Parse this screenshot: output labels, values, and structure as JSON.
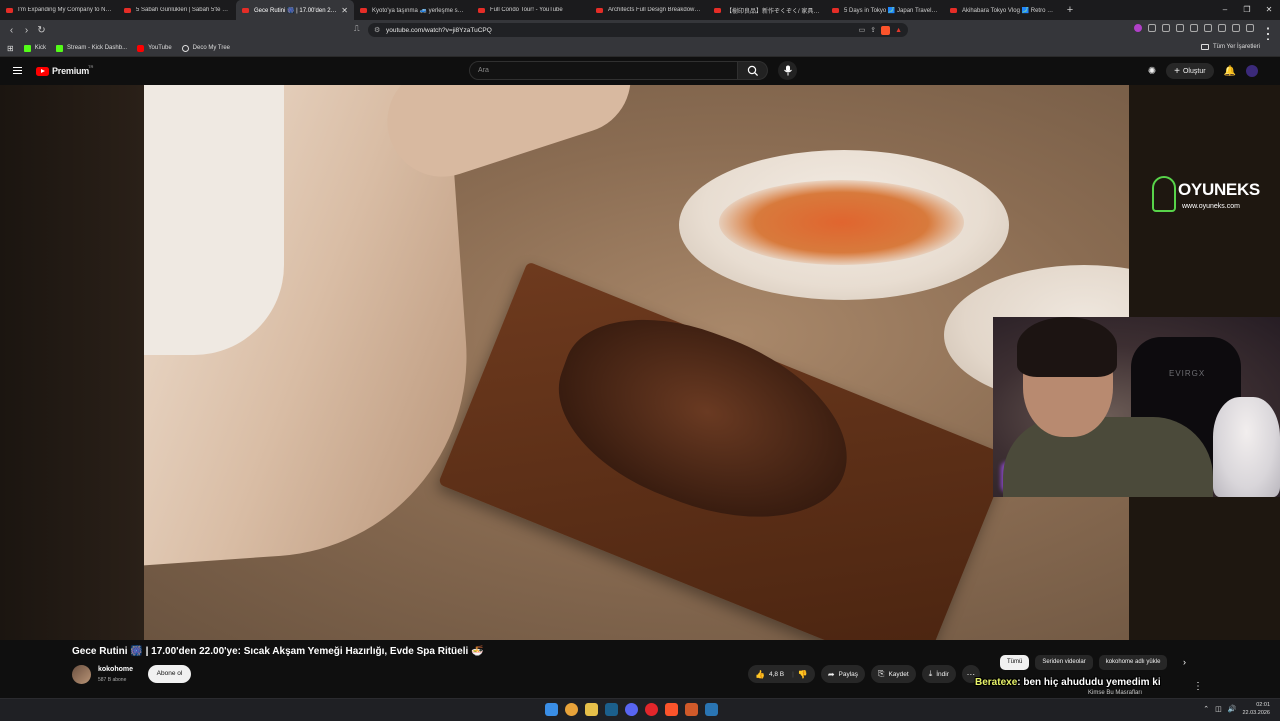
{
  "browser": {
    "tabs": [
      {
        "title": "I'm Expanding My Company to New",
        "active": false
      },
      {
        "title": "5 Sabah Günlükleri | Sabah 5'te uyan",
        "active": false
      },
      {
        "title": "Gece Rutini 🎆 | 17.00'den 22.0",
        "active": true
      },
      {
        "title": "Kyoto'ya taşınma 🚙 yerleşme süreci",
        "active": false
      },
      {
        "title": "Full Condo Tour! - YouTube",
        "active": false
      },
      {
        "title": "Architects Full Design Breakdown of",
        "active": false
      },
      {
        "title": "【樹印良品】新作ぞくぞく/ 家具が良さ",
        "active": false
      },
      {
        "title": "5 Days in Tokyo 🗾 Japan Travel Vlog",
        "active": false
      },
      {
        "title": "Akihabara Tokyo Vlog 🗾 Retro Game",
        "active": false
      }
    ],
    "close_tab_glyph": "✕",
    "new_tab_glyph": "+",
    "window_controls": [
      "–",
      "❐",
      "✕"
    ],
    "url": "youtube.com/watch?v=ji8YzaTuCPQ",
    "bookmarks": [
      {
        "label": "Kick",
        "color": "#53fc18"
      },
      {
        "label": "Stream - Kick Dashb...",
        "color": "#53fc18"
      },
      {
        "label": "YouTube",
        "color": "#ff0000"
      },
      {
        "label": "Deco My Tree",
        "color": "#dddddd"
      }
    ],
    "all_bookmarks_label": "Tüm Yer İşaretleri"
  },
  "youtube": {
    "logo_text": "Premium",
    "logo_region": "TR",
    "search_placeholder": "Ara",
    "create_label": "Oluştur",
    "video_title": "Gece Rutini 🎆 | 17.00'den 22.00'ye: Sıcak Akşam Yemeği Hazırlığı, Evde Spa Ritüeli 🍜",
    "channel_name": "kokohome",
    "subscribers": "587 B abone",
    "subscribe_label": "Abone ol",
    "like_count": "4,8 B",
    "share_label": "Paylaş",
    "save_label": "Kaydet",
    "download_label": "İndir",
    "chips": [
      "Tümü",
      "Seriden videolar",
      "kokohome adlı yükle"
    ],
    "side_video_title": "Kimse Bu Masrafları"
  },
  "stream_overlay": {
    "watermark_name": "OYUNEKS",
    "watermark_url": "www.oyuneks.com",
    "chair_brand": "EVIRGX",
    "chat_user": "Beratexe",
    "chat_message": ": ben hiç ahududu yemedim ki"
  },
  "taskbar": {
    "time": "02:01",
    "date": "22.03.2026",
    "icons": [
      {
        "name": "windows-start-icon",
        "color": "#3a8ee6"
      },
      {
        "name": "chrome-icon",
        "color": "#e8a33a"
      },
      {
        "name": "file-explorer-icon",
        "color": "#e6c04a"
      },
      {
        "name": "steam-icon",
        "color": "#1b5f8c"
      },
      {
        "name": "discord-icon",
        "color": "#5865f2"
      },
      {
        "name": "opera-icon",
        "color": "#e3262b"
      },
      {
        "name": "brave-icon",
        "color": "#fb542b"
      },
      {
        "name": "steelseries-icon",
        "color": "#d05a2a"
      },
      {
        "name": "steam-icon-2",
        "color": "#2a75b3"
      }
    ]
  },
  "colors": {
    "youtube_red": "#ff0000",
    "background": "#0f0f0f",
    "watermark_green": "#58d34a"
  }
}
